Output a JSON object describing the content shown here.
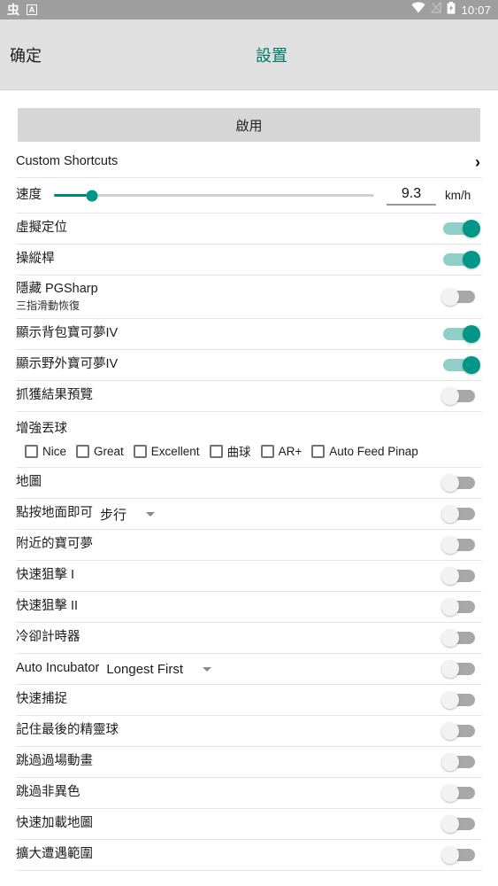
{
  "statusbar": {
    "ime_icon": "ime-chinese-icon",
    "a_icon": "a-letter-badge-icon",
    "wifi_icon": "wifi-icon",
    "signal_icon": "signal-off-icon",
    "battery_icon": "battery-charging-icon",
    "time": "10:07"
  },
  "actionbar": {
    "confirm_label": "确定",
    "title": "設置",
    "accent_color": "#00796b",
    "background_color": "#e0e0e0"
  },
  "main": {
    "enable_button_label": "啟用",
    "shortcuts": {
      "label": "Custom Shortcuts",
      "chevron": "›"
    },
    "speed": {
      "label": "速度",
      "value": "9.3",
      "unit": "km/h",
      "fill_percent": 12
    },
    "toggles": [
      {
        "label": "虛擬定位",
        "state": "on"
      },
      {
        "label": "操縱桿",
        "state": "on"
      },
      {
        "label": "隱藏 PGSharp",
        "sub": "三指滑動恢復",
        "state": "off"
      },
      {
        "label": "顯示背包寶可夢IV",
        "state": "on"
      },
      {
        "label": "顯示野外寶可夢IV",
        "state": "on"
      },
      {
        "label": "抓獲結果預覽",
        "state": "off"
      }
    ],
    "throw": {
      "title": "增強丟球",
      "options": [
        {
          "label": "Nice",
          "checked": false
        },
        {
          "label": "Great",
          "checked": false
        },
        {
          "label": "Excellent",
          "checked": false
        },
        {
          "label": "曲球",
          "checked": false
        },
        {
          "label": "AR+",
          "checked": false
        },
        {
          "label": "Auto Feed Pinap",
          "checked": false
        }
      ]
    },
    "toggles2": [
      {
        "label": "地圖",
        "state": "off"
      }
    ],
    "tap_to_walk": {
      "label": "點按地面即可",
      "dropdown_value": "步行",
      "state": "off"
    },
    "toggles3": [
      {
        "label": "附近的寶可夢",
        "state": "off"
      },
      {
        "label": "快速狙擊 I",
        "state": "off"
      },
      {
        "label": "快速狙擊 II",
        "state": "off"
      },
      {
        "label": "冷卻計時器",
        "state": "off"
      }
    ],
    "auto_incubator": {
      "label": "Auto Incubator",
      "dropdown_value": "Longest First",
      "state": "off"
    },
    "toggles4": [
      {
        "label": "快速捕捉",
        "state": "off"
      },
      {
        "label": "記住最後的精靈球",
        "state": "off"
      },
      {
        "label": "跳過過場動畫",
        "state": "off"
      },
      {
        "label": "跳過非異色",
        "state": "off"
      },
      {
        "label": "快速加載地圖",
        "state": "off"
      },
      {
        "label": "擴大遭遇範圍",
        "state": "off"
      }
    ]
  }
}
